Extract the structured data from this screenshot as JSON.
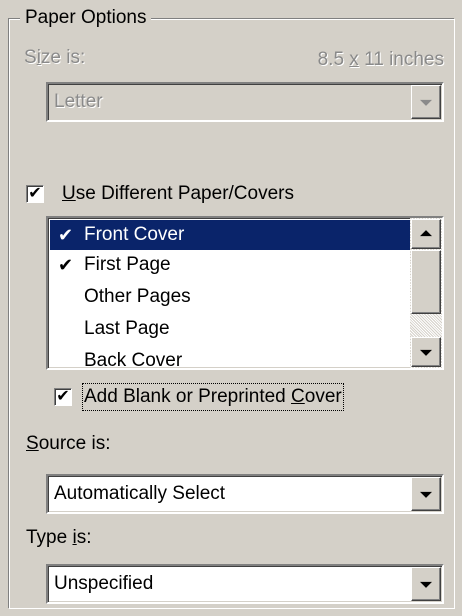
{
  "group": {
    "title": "Paper Options"
  },
  "size": {
    "label_pre": "S",
    "label_u": "i",
    "label_post": "ze is:",
    "dims_pre": "8.5 ",
    "dims_u": "x",
    "dims_post": " 11 inches",
    "value": "Letter"
  },
  "use_different": {
    "checked": true,
    "check_glyph": "✔",
    "label_u": "U",
    "label_post": "se Different Paper/Covers"
  },
  "pages_list": {
    "items": [
      {
        "label": "Front Cover",
        "checked": true,
        "check_glyph": "✔",
        "selected": true
      },
      {
        "label": "First Page",
        "checked": true,
        "check_glyph": "✔",
        "selected": false
      },
      {
        "label": "Other Pages",
        "checked": false,
        "check_glyph": "",
        "selected": false
      },
      {
        "label": "Last Page",
        "checked": false,
        "check_glyph": "",
        "selected": false
      },
      {
        "label": "Back Cover",
        "checked": false,
        "check_glyph": "",
        "selected": false
      }
    ]
  },
  "add_blank": {
    "checked": true,
    "check_glyph": "✔",
    "label_pre": "Add Blank or Preprinted ",
    "label_u": "C",
    "label_post": "over"
  },
  "source": {
    "label_u": "S",
    "label_post": "ource is:",
    "value": "Automatically Select"
  },
  "type": {
    "label_pre": "Type ",
    "label_u": "i",
    "label_post": "s:",
    "value": "Unspecified"
  },
  "colors": {
    "selection": "#0a246a",
    "face": "#d4d0c8",
    "disabled_text": "#8a8a8a"
  },
  "icons": {
    "dropdown": "chevron-down-icon",
    "scroll_up": "arrow-up-icon",
    "scroll_down": "arrow-down-icon",
    "check": "checkmark-icon"
  }
}
